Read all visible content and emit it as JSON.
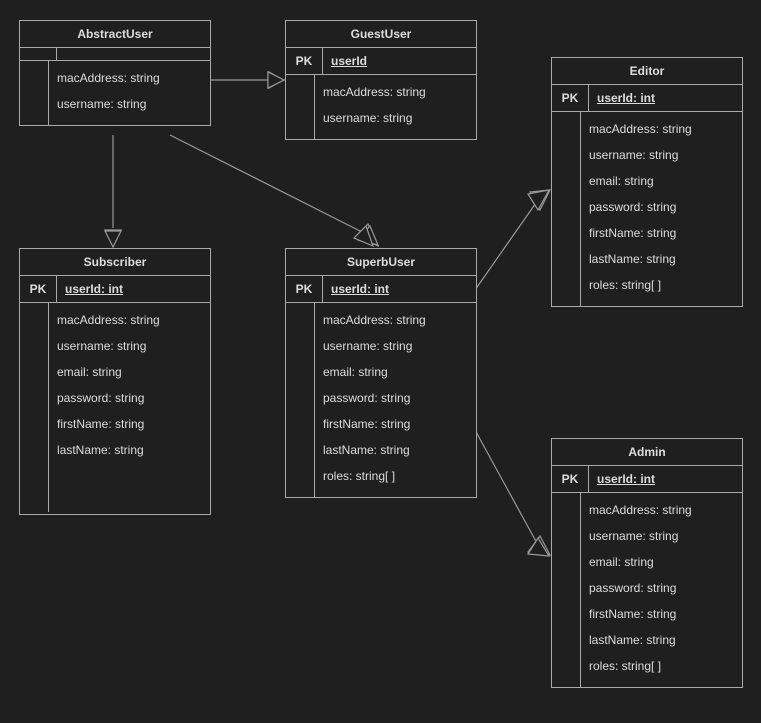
{
  "entities": {
    "abstractUser": {
      "title": "AbstractUser",
      "pkLabel": "",
      "pkValue": "",
      "attrs": [
        "macAddress: string",
        "username: string"
      ]
    },
    "guestUser": {
      "title": "GuestUser",
      "pkLabel": "PK",
      "pkValue": "userId",
      "attrs": [
        "macAddress: string",
        "username: string"
      ]
    },
    "subscriber": {
      "title": "Subscriber",
      "pkLabel": "PK",
      "pkValue": "userId: int",
      "attrs": [
        "macAddress: string",
        "username: string",
        "email: string",
        "password: string",
        "firstName: string",
        "lastName: string"
      ]
    },
    "superbUser": {
      "title": "SuperbUser",
      "pkLabel": "PK",
      "pkValue": "userId: int",
      "attrs": [
        "macAddress: string",
        "username: string",
        "email: string",
        "password: string",
        "firstName: string",
        "lastName: string",
        "roles: string[ ]"
      ]
    },
    "editor": {
      "title": "Editor",
      "pkLabel": "PK",
      "pkValue": "userId: int",
      "attrs": [
        "macAddress: string",
        "username: string",
        "email: string",
        "password: string",
        "firstName: string",
        "lastName: string",
        "roles: string[ ]"
      ]
    },
    "admin": {
      "title": "Admin",
      "pkLabel": "PK",
      "pkValue": "userId: int",
      "attrs": [
        "macAddress: string",
        "username: string",
        "email: string",
        "password: string",
        "firstName: string",
        "lastName: string",
        "roles: string[ ]"
      ]
    }
  }
}
